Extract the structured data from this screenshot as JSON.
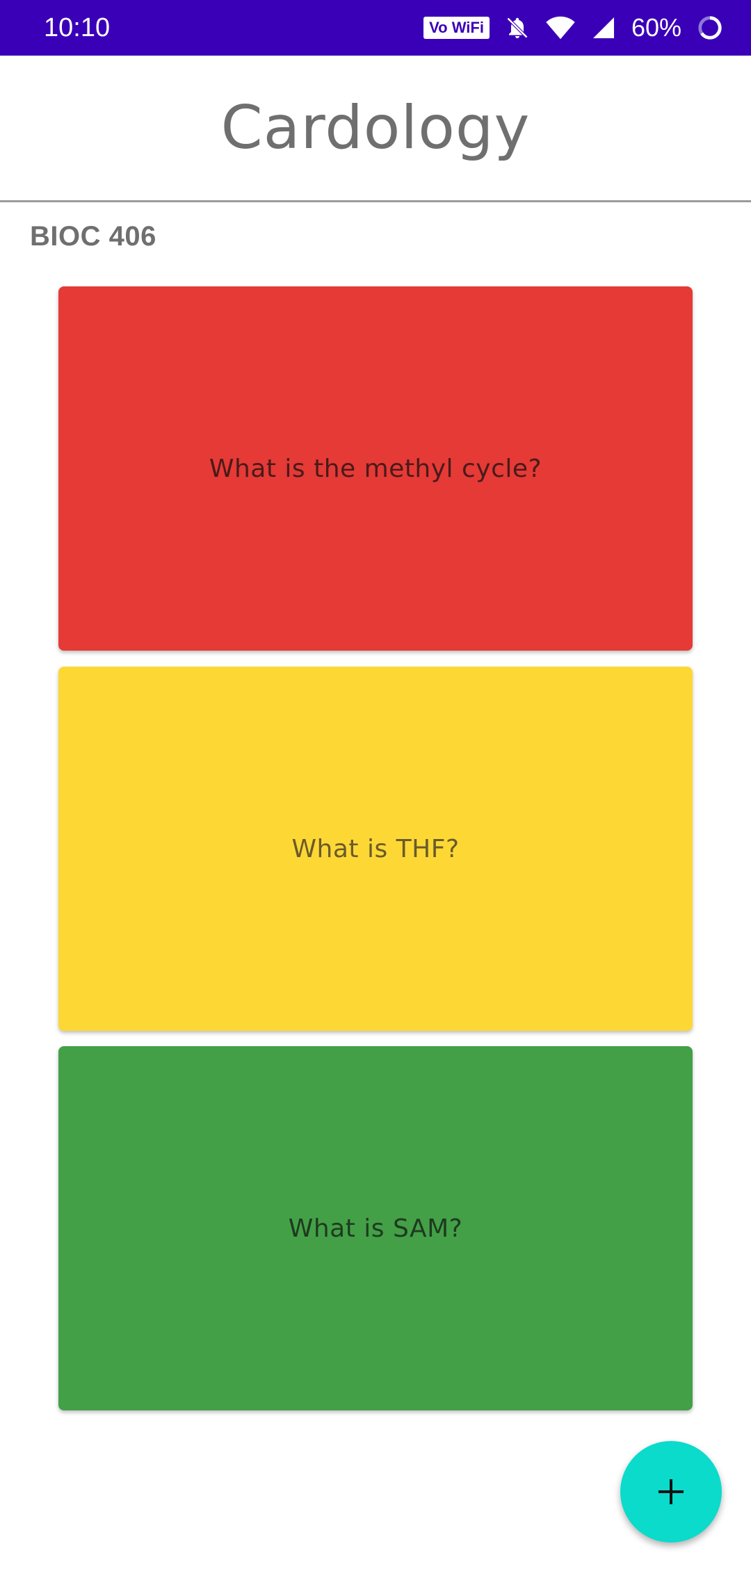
{
  "status_bar": {
    "time": "10:10",
    "vowifi_label": "Vo WiFi",
    "battery_percent": "60%",
    "icons": [
      "vowifi-icon",
      "bell-off-icon",
      "wifi-icon",
      "signal-icon",
      "battery-circle-icon"
    ],
    "bg_color": "#3a00b8"
  },
  "header": {
    "title": "Cardology"
  },
  "deck": {
    "name": "BIOC 406"
  },
  "cards": [
    {
      "question": "What is the methyl cycle?",
      "color": "#e53a36",
      "text_color": "#4a1a1a"
    },
    {
      "question": "What is THF?",
      "color": "#fdd835",
      "text_color": "#6a5a2a"
    },
    {
      "question": "What is SAM?",
      "color": "#43a047",
      "text_color": "#1f3a1f"
    }
  ],
  "fab": {
    "icon": "plus-icon",
    "color": "#0adbcb"
  }
}
